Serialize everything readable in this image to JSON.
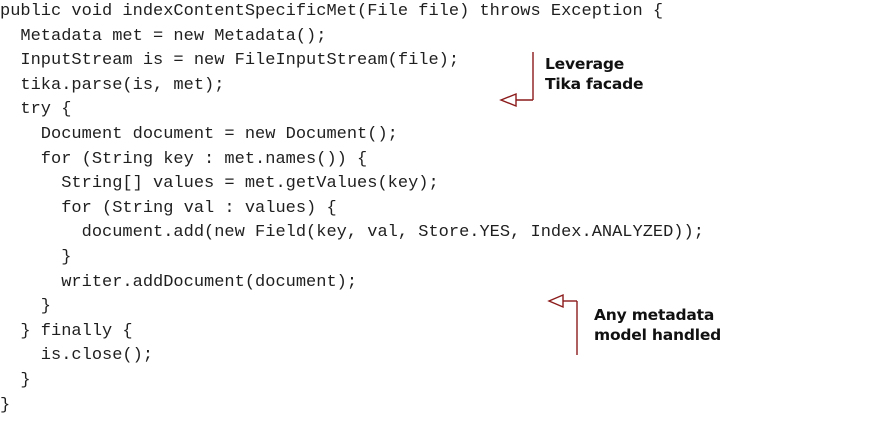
{
  "code_listing": {
    "lines": [
      "public void indexContentSpecificMet(File file) throws Exception {",
      "  Metadata met = new Metadata();",
      "  InputStream is = new FileInputStream(file);",
      "  tika.parse(is, met);",
      "  try {",
      "    Document document = new Document();",
      "    for (String key : met.names()) {",
      "      String[] values = met.getValues(key);",
      "      for (String val : values) {",
      "        document.add(new Field(key, val, Store.YES, Index.ANALYZED));",
      "      }",
      "      writer.addDocument(document);",
      "    }",
      "  } finally {",
      "    is.close();",
      "  }",
      "}"
    ]
  },
  "annotations": [
    {
      "lines": [
        "Leverage",
        "Tika facade"
      ],
      "color": "#8b1a1a"
    },
    {
      "lines": [
        "Any metadata",
        "model handled"
      ],
      "color": "#8b1a1a"
    }
  ]
}
